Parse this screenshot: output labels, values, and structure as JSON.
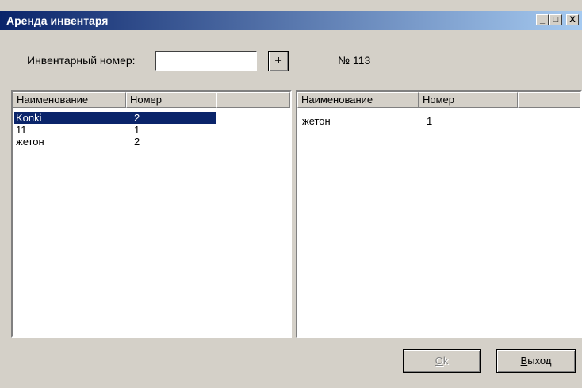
{
  "window": {
    "title": "Аренда инвентаря",
    "controls": {
      "minimize": "_",
      "maximize": "□",
      "close": "X"
    }
  },
  "form": {
    "inventory_label": "Инвентарный номер:",
    "inventory_value": "",
    "add_label": "+",
    "order_number": "№  113"
  },
  "left_list": {
    "columns": [
      "Наименование",
      "Номер",
      ""
    ],
    "rows": [
      {
        "name": "Konki",
        "number": "2",
        "selected": true
      },
      {
        "name": "11",
        "number": "1",
        "selected": false
      },
      {
        "name": "жетон",
        "number": "2",
        "selected": false
      }
    ]
  },
  "right_list": {
    "columns": [
      "Наименование",
      "Номер",
      ""
    ],
    "rows": [
      {
        "name": "жетон",
        "number": "1"
      }
    ]
  },
  "buttons": {
    "ok": {
      "accel": "O",
      "rest": "k"
    },
    "exit": {
      "accel": "В",
      "rest": "ыход"
    }
  }
}
